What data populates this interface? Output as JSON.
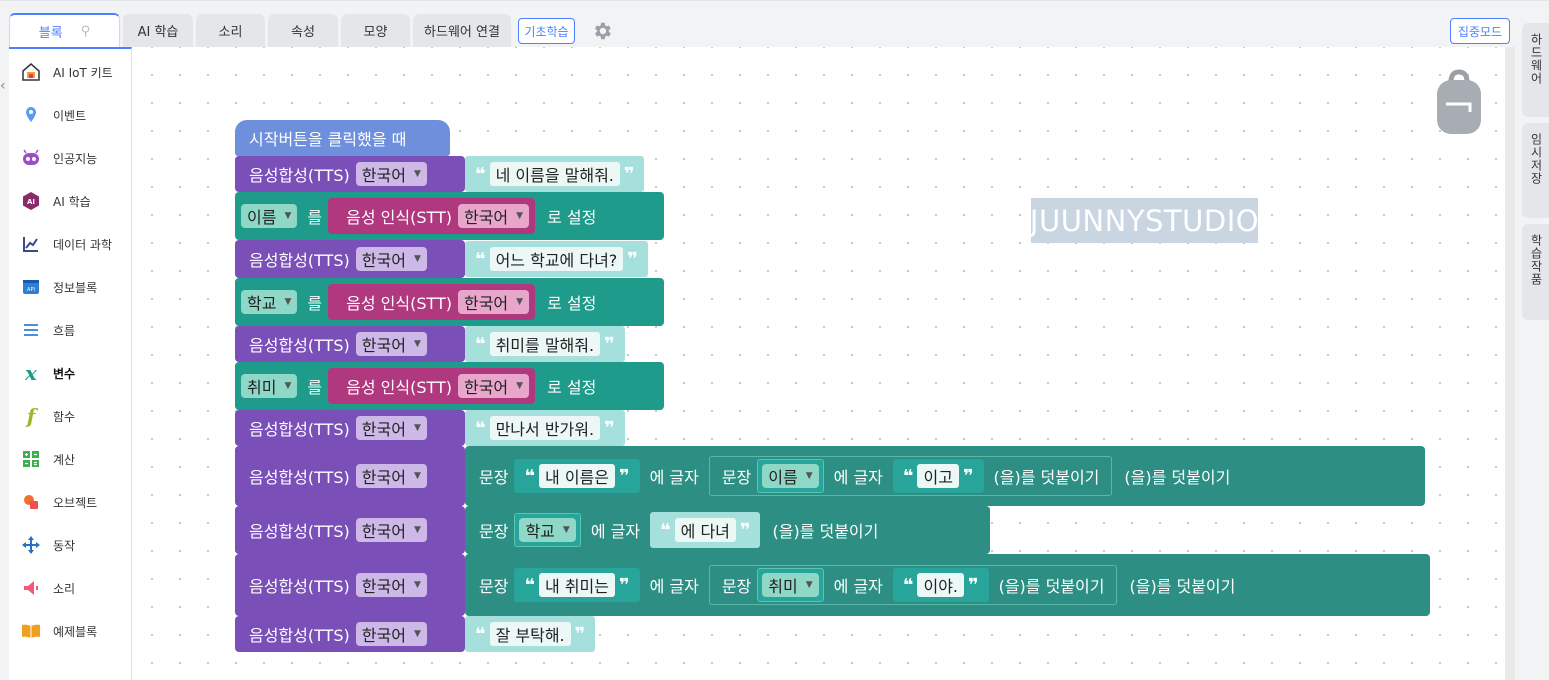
{
  "tabs": [
    {
      "label": "블록",
      "pin": "⚲"
    },
    {
      "label": "AI 학습"
    },
    {
      "label": "소리"
    },
    {
      "label": "속성"
    },
    {
      "label": "모양"
    },
    {
      "label": "하드웨어 연결"
    }
  ],
  "basic_learning_label": "기초학습",
  "focus_mode_label": "집중모드",
  "categories": [
    {
      "label": "AI IoT 키트"
    },
    {
      "label": "이벤트"
    },
    {
      "label": "인공지능"
    },
    {
      "label": "AI 학습"
    },
    {
      "label": "데이터 과학"
    },
    {
      "label": "정보블록"
    },
    {
      "label": "흐름"
    },
    {
      "label": "변수"
    },
    {
      "label": "함수"
    },
    {
      "label": "계산"
    },
    {
      "label": "오브젝트"
    },
    {
      "label": "동작"
    },
    {
      "label": "소리"
    },
    {
      "label": "예제블록"
    }
  ],
  "right_tabs": [
    "하드웨어",
    "임시저장",
    "학습작품"
  ],
  "watermark": "JUUNNYSTUDIO",
  "blocks": {
    "hat": "시작버튼을 클릭했을 때",
    "tts": "음성합성(TTS)",
    "lang": "한국어",
    "stt": "음성 인식(STT)",
    "to": "를",
    "set": "로 설정",
    "sentence": "문장",
    "letter": "에 글자",
    "attach": "(을)를 덧붙이기",
    "say1": "네 이름을 말해줘.",
    "var_name": "이름",
    "say2": "어느 학교에 다녀?",
    "var_school": "학교",
    "say3": "취미를 말해줘.",
    "var_hobby": "취미",
    "say4": "만나서 반가워.",
    "s_myname": "내 이름은",
    "s_igo": "이고",
    "s_attend": "에 다녀",
    "s_myhobby": "내 취미는",
    "s_iya": "이야.",
    "say5": "잘 부탁해."
  }
}
